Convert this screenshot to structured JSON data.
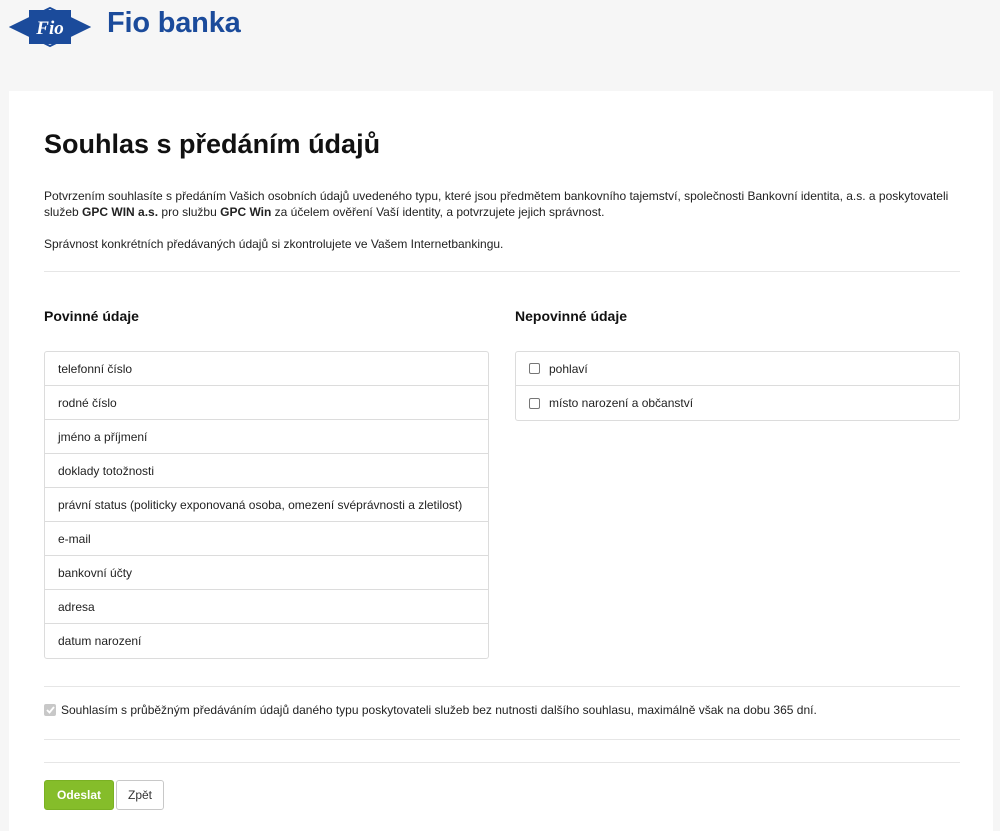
{
  "brand": {
    "logo_text": "Fio",
    "name": "Fio banka",
    "color": "#1b4b9b"
  },
  "page": {
    "title": "Souhlas s předáním údajů",
    "intro": {
      "p1_a": "Potvrzením souhlasíte s předáním Vašich osobních údajů uvedeného typu, které jsou předmětem bankovního tajemství, společnosti Bankovní identita, a.s. a poskytovateli služeb ",
      "p1_b": "GPC ",
      "p1_c": "WIN a.s.",
      "p1_d": " pro službu ",
      "p1_e": "GPC Win",
      "p1_f": " za účelem ověření Vaší identity, a potvrzujete jejich správnost.",
      "p2": "Správnost konkrétních předávaných údajů si zkontrolujete ve Vašem Internetbankingu."
    }
  },
  "required": {
    "title": "Povinné údaje",
    "items": [
      "telefonní číslo",
      "rodné číslo",
      "jméno a příjmení",
      "doklady totožnosti",
      "právní status (politicky exponovaná osoba, omezení svéprávnosti a zletilost)",
      "e-mail",
      "bankovní účty",
      "adresa",
      "datum narození"
    ]
  },
  "optional": {
    "title": "Nepovinné údaje",
    "items": [
      {
        "label": "pohlaví",
        "checked": false
      },
      {
        "label": "místo narození a občanství",
        "checked": false
      }
    ]
  },
  "consent": {
    "label": "Souhlasím s průběžným předáváním údajů daného typu poskytovateli služeb bez nutnosti dalšího souhlasu, maximálně však na dobu 365 dní.",
    "checked": true,
    "disabled": true
  },
  "actions": {
    "submit_label": "Odeslat",
    "back_label": "Zpět"
  },
  "colors": {
    "accent": "#85bd2a",
    "background": "#f6f6f6",
    "border": "#dcdcdc"
  }
}
